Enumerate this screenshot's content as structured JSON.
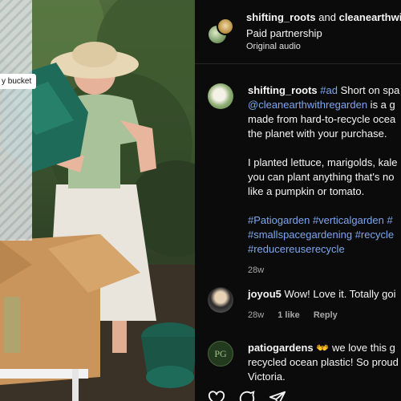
{
  "media": {
    "tag_label": "y bucket"
  },
  "header": {
    "user1": "shifting_roots",
    "connector": " and ",
    "user2": "cleanearthwi",
    "line2": "Paid partnership",
    "line3": "Original audio"
  },
  "caption": {
    "username": "shifting_roots",
    "hashtag_ad": "#ad",
    "line1_rest": " Short on spa",
    "line2_mention": "@cleanearthwithregarden",
    "line2_rest": " is a g",
    "line3": "made from hard-to-recycle ocea",
    "line4": "the planet with your purchase.",
    "line5": "I planted lettuce, marigolds, kale",
    "line6": "you can plant anything that's no",
    "line7": "like a pumpkin or tomato.",
    "tags1": "#Patiogarden #verticalgarden #",
    "tags2": "#smallspacegardening #recycle",
    "tags3": "#reducereuserecycle",
    "time": "28w"
  },
  "comments": [
    {
      "username": "joyou5",
      "text": " Wow! Love it. Totally goi",
      "time": "28w",
      "likes": "1 like",
      "reply": "Reply"
    },
    {
      "avatar_text": "PG",
      "username": "patiogardens",
      "line1_rest": " 👐 we love this g",
      "line2": "recycled ocean plastic! So proud",
      "line3": "Victoria."
    }
  ],
  "colors": {
    "background": "#0b0b0b",
    "link": "#7da7ef",
    "muted": "#a8a8a8"
  }
}
